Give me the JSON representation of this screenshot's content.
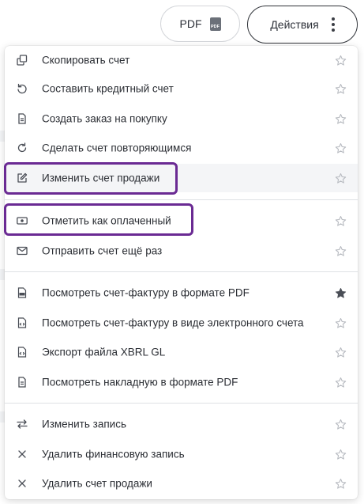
{
  "toolbar": {
    "pdf_label": "PDF",
    "pdf_icon_text": "PDF",
    "actions_label": "Действия"
  },
  "menu": {
    "items": [
      {
        "label": "Скопировать счет",
        "icon": "copy-icon",
        "favorite": false
      },
      {
        "label": "Составить кредитный счет",
        "icon": "undo-icon",
        "favorite": false
      },
      {
        "label": "Создать заказ на покупку",
        "icon": "document-icon",
        "favorite": false
      },
      {
        "label": "Сделать счет повторяющимся",
        "icon": "refresh-icon",
        "favorite": false
      },
      {
        "label": "Изменить счет продажи",
        "icon": "edit-icon",
        "favorite": false
      },
      {
        "label": "Отметить как оплаченный",
        "icon": "cash-icon",
        "favorite": false
      },
      {
        "label": "Отправить счет ещё раз",
        "icon": "mail-icon",
        "favorite": false
      },
      {
        "label": "Посмотреть счет-фактуру в формате PDF",
        "icon": "pdf-file-icon",
        "favorite": true
      },
      {
        "label": "Посмотреть счет-фактуру в виде электронного счета",
        "icon": "code-file-icon",
        "favorite": false
      },
      {
        "label": "Экспорт файла XBRL GL",
        "icon": "code-file-icon",
        "favorite": false
      },
      {
        "label": "Посмотреть накладную в формате PDF",
        "icon": "document-icon",
        "favorite": false
      },
      {
        "label": "Изменить запись",
        "icon": "swap-icon",
        "favorite": false
      },
      {
        "label": "Удалить финансовую запись",
        "icon": "close-icon",
        "favorite": false
      },
      {
        "label": "Удалить счет продажи",
        "icon": "close-icon",
        "favorite": false
      }
    ]
  },
  "colors": {
    "highlight": "#6a2a93",
    "star_outline": "#b8bbc1",
    "star_filled": "#4a4e56"
  }
}
